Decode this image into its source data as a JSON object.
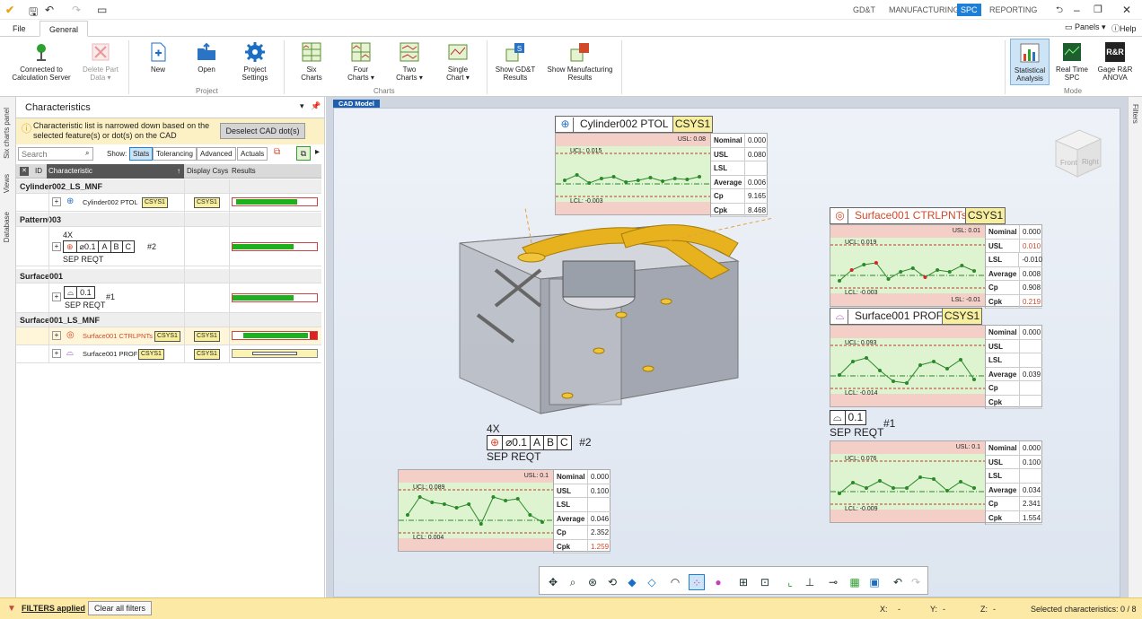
{
  "titlebar": {
    "modes": [
      "GD&T",
      "MANUFACTURING",
      "SPC",
      "REPORTING"
    ],
    "active_mode": "SPC",
    "panels": "Panels",
    "help": "Help"
  },
  "ribbon": {
    "tabs": [
      "File",
      "General"
    ],
    "buttons": {
      "connect": "Connected to Calculation Server",
      "delete": "Delete Part Data",
      "new": "New",
      "open": "Open",
      "settings": "Project Settings",
      "six": "Six Charts",
      "four": "Four Charts",
      "two": "Two Charts",
      "single": "Single Chart",
      "gdt": "Show GD&T Results",
      "mfg": "Show Manufacturing Results",
      "stat": "Statistical Analysis",
      "realtime": "Real Time SPC",
      "rr": "Gage R&R ANOVA"
    },
    "groups": {
      "project": "Project",
      "charts": "Charts",
      "mode": "Mode"
    },
    "rr_icon": "R&R"
  },
  "lefttabs": [
    "Six charts panel",
    "Views",
    "Database"
  ],
  "righttabs": [
    "Filters"
  ],
  "panel": {
    "title": "Characteristics",
    "info": "Characteristic list is narrowed down based on the selected feature(s) or dot(s) on the CAD",
    "deselect": "Deselect CAD dot(s)",
    "search_placeholder": "Search",
    "show_label": "Show:",
    "filters": [
      "Stats",
      "Tolerancing",
      "Advanced",
      "Actuals"
    ],
    "columns": [
      "ID",
      "Characteristic",
      "Display Csys",
      "Results"
    ],
    "groups": [
      {
        "name": "Cylinder002_LS_MNF",
        "items": [
          {
            "label": "Cylinder002 PTOL",
            "csys": "CSYS1",
            "dcsys": "CSYS1"
          }
        ]
      },
      {
        "name": "Pattern003",
        "items": [
          {
            "pre": "4X",
            "fcf": [
              "⌀0.1",
              "A",
              "B",
              "C"
            ],
            "num": "#2",
            "post": "SEP REQT"
          }
        ]
      },
      {
        "name": "Surface001",
        "items": [
          {
            "fcf": [
              "0.1"
            ],
            "num": "#1",
            "post": "SEP REQT"
          }
        ]
      },
      {
        "name": "Surface001_LS_MNF",
        "items": [
          {
            "label": "Surface001 CTRLPNTs",
            "csys": "CSYS1",
            "dcsys": "CSYS1"
          },
          {
            "label": "Surface001 PROF",
            "csys": "CSYS1",
            "dcsys": "CSYS1"
          }
        ]
      }
    ]
  },
  "cad": {
    "tab": "CAD Model",
    "cube": [
      "Front",
      "Right"
    ]
  },
  "cards": [
    {
      "title": "Cylinder002 PTOL",
      "csys": "CSYS1",
      "usl_line": "USL: 0.08",
      "ucl": "UCL: 0.015",
      "lcl": "LCL: -0.003",
      "lsl_line": "",
      "stats": [
        [
          "Nominal",
          "0.000"
        ],
        [
          "USL",
          "0.080"
        ],
        [
          "LSL",
          ""
        ],
        [
          "Average",
          "0.006"
        ],
        [
          "Cp",
          "9.165"
        ],
        [
          "Cpk",
          "8.468"
        ]
      ],
      "red": []
    },
    {
      "title": "Surface001 CTRLPNTs",
      "csys": "CSYS1",
      "usl_line": "USL: 0.01",
      "ucl": "UCL: 0.019",
      "lcl": "LCL: -0.003",
      "lsl_line": "LSL: -0.01",
      "stats": [
        [
          "Nominal",
          "0.000"
        ],
        [
          "USL",
          "0.010"
        ],
        [
          "LSL",
          "-0.010"
        ],
        [
          "Average",
          "0.008"
        ],
        [
          "Cp",
          "0.908"
        ],
        [
          "Cpk",
          "0.219"
        ]
      ],
      "red": [
        "USL",
        "Cpk"
      ]
    },
    {
      "title": "Surface001 PROF",
      "csys": "CSYS1",
      "usl_line": "",
      "ucl": "UCL: 0.093",
      "lcl": "LCL: -0.014",
      "lsl_line": "",
      "stats": [
        [
          "Nominal",
          "0.000"
        ],
        [
          "USL",
          ""
        ],
        [
          "LSL",
          ""
        ],
        [
          "Average",
          "0.039"
        ],
        [
          "Cp",
          ""
        ],
        [
          "Cpk",
          ""
        ]
      ],
      "red": []
    },
    {
      "title": "",
      "csys": "",
      "usl_line": "USL: 0.1",
      "ucl": "UCL: 0.076",
      "lcl": "LCL: -0.009",
      "lsl_line": "",
      "stats": [
        [
          "Nominal",
          "0.000"
        ],
        [
          "USL",
          "0.100"
        ],
        [
          "LSL",
          ""
        ],
        [
          "Average",
          "0.034"
        ],
        [
          "Cp",
          "2.341"
        ],
        [
          "Cpk",
          "1.554"
        ]
      ],
      "red": []
    },
    {
      "title": "",
      "csys": "",
      "usl_line": "USL: 0.1",
      "ucl": "UCL: 0.089",
      "lcl": "LCL: 0.004",
      "lsl_line": "",
      "stats": [
        [
          "Nominal",
          "0.000"
        ],
        [
          "USL",
          "0.100"
        ],
        [
          "LSL",
          ""
        ],
        [
          "Average",
          "0.046"
        ],
        [
          "Cp",
          "2.352"
        ],
        [
          "Cpk",
          "1.259"
        ]
      ],
      "red": [
        "Cpk"
      ]
    }
  ],
  "callouts": {
    "pattern": {
      "pre": "4X",
      "fcf": [
        "⌀0.1",
        "A",
        "B",
        "C"
      ],
      "num": "#2",
      "post": "SEP REQT"
    },
    "surface": {
      "fcf": [
        "0.1"
      ],
      "num": "#1",
      "post": "SEP REQT"
    }
  },
  "status": {
    "filters": "FILTERS applied",
    "clear": "Clear all filters",
    "x": "X:",
    "y": "Y:",
    "z": "Z:",
    "dash": "-",
    "selected": "Selected characteristics: 0 / 8"
  }
}
